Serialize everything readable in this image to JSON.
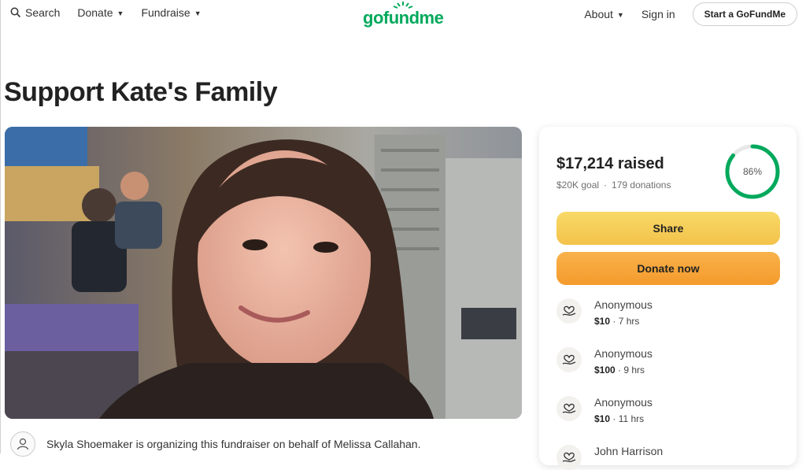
{
  "header": {
    "search_label": "Search",
    "donate_label": "Donate",
    "fundraise_label": "Fundraise",
    "logo_text": "gofundme",
    "about_label": "About",
    "signin_label": "Sign in",
    "start_label": "Start a GoFundMe"
  },
  "page": {
    "title": "Support Kate's Family"
  },
  "organizer": {
    "text": "Skyla Shoemaker is organizing this fundraiser on behalf of Melissa Callahan."
  },
  "donation_card": {
    "raised": "$17,214 raised",
    "goal": "$20K goal",
    "separator": "·",
    "donations": "179 donations",
    "progress_label": "86%",
    "progress_fraction": 0.86,
    "share_label": "Share",
    "donate_now_label": "Donate now",
    "donors": [
      {
        "name": "Anonymous",
        "amount": "$10",
        "time": "· 7 hrs"
      },
      {
        "name": "Anonymous",
        "amount": "$100",
        "time": "· 9 hrs"
      },
      {
        "name": "Anonymous",
        "amount": "$10",
        "time": "· 11 hrs"
      },
      {
        "name": "John Harrison",
        "amount": "",
        "time": ""
      }
    ]
  },
  "colors": {
    "brand_green": "#02a95c",
    "share_yellow": "#f5cb55",
    "donate_orange": "#f6a63a"
  },
  "icons": {
    "search": "search-icon",
    "caret": "chevron-down-icon",
    "donor": "heart-hand-icon",
    "organizer": "user-icon"
  }
}
